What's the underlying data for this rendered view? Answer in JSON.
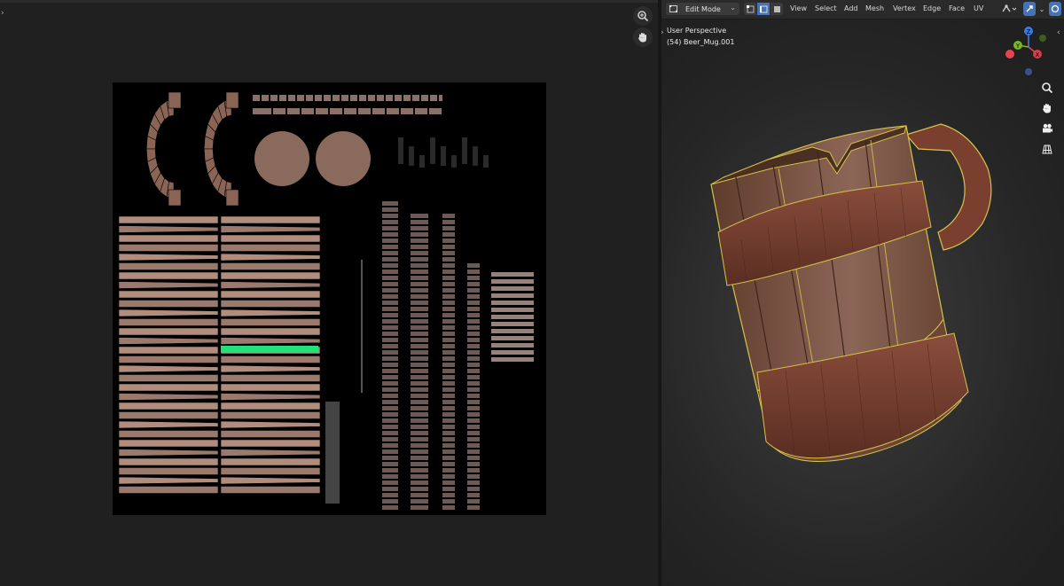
{
  "uv_editor": {
    "zoom_tool": "zoom-icon",
    "pan_tool": "hand-icon"
  },
  "viewport": {
    "header": {
      "mode": "Edit Mode",
      "menus": [
        "View",
        "Select",
        "Add",
        "Mesh",
        "Vertex",
        "Edge",
        "Face",
        "UV"
      ]
    },
    "view_name": "User Perspective",
    "object_label": "(54) Beer_Mug.001",
    "gizmo_axes": {
      "x": "X",
      "y": "Y",
      "z": "Z"
    },
    "nav_icons": [
      "zoom-icon",
      "hand-icon",
      "camera-icon",
      "grid-icon"
    ]
  },
  "colors": {
    "selection_accent": "#4772b3",
    "uv_selected": "#22e07a",
    "wood": "#8a6556",
    "edge_yellow": "#d6c34a",
    "axis_x": "#e8434f",
    "axis_y": "#78b823",
    "axis_z": "#3b7ae0"
  }
}
